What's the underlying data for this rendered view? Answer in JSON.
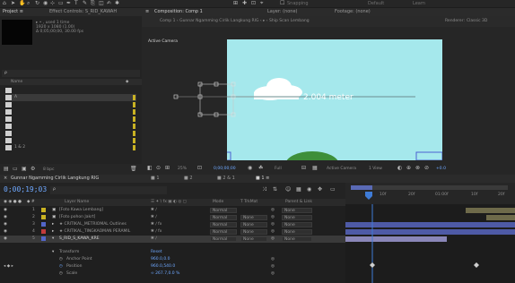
{
  "toolbar": {
    "snapping_label": "Snapping",
    "default_label": "Default",
    "learn_label": "Learn"
  },
  "project_panel": {
    "tab_label": "Project  ≡",
    "effect_tab_label": "Effect Controls: S_RID_KAWAH",
    "meta_lines": [
      "▸ • , used 1 time",
      "1920 x 1080 (1.00)",
      "Δ 0;05;00;00, 30.00 fps"
    ],
    "search_placeholder": "ρ",
    "column_name": "Name",
    "items": [
      "",
      "A",
      "",
      "",
      "",
      "",
      "",
      "",
      "1 & 2"
    ],
    "bpc": "8 bpc"
  },
  "viewer": {
    "tab_label": "Composition: Comp 1",
    "layer_tab": "Layer: (none)",
    "footage_tab": "Footage: (none)",
    "breadcrumb": "Comp 1  ‹  Gunnar Ngamming Cirlik Langkung RIG  ‹  ▸  ‹  Ship Scan Lembang",
    "renderer_label": "Renderer:",
    "renderer_value": "Classic 3D",
    "active_camera_overlay": "Active Camera",
    "distance_text": "2.004 meter",
    "footer": {
      "zoom": "25%",
      "timecode": "0;00;00;00",
      "resolution": "Full",
      "camera": "Active Camera",
      "view": "1 View",
      "exposure": "+0.0"
    }
  },
  "timeline": {
    "tab_label": "Gunnar Ngamming Cirlik Langkung RIG",
    "tab2": "■ 1",
    "tab3": "■ 2",
    "tab4": "■ 2 & 1",
    "tab5": "■ 1  ≡",
    "timecode": "0;00;19;03",
    "search_placeholder": "ρ",
    "ruler_ticks": [
      "10f",
      "20f",
      "01:00f",
      "10f",
      "20f"
    ],
    "columns": {
      "layer_name": "Layer Name",
      "switches": "☰ ✦ \\ fx ▣ ◐ ◎ ▢",
      "mode": "Mode",
      "trkmat": "T  TrkMat",
      "parent": "Parent & Link"
    },
    "layers": [
      {
        "num": "1",
        "name": "[Foto Kawa Lembang]",
        "mode": "Normal",
        "trkmat": "",
        "parent": "None",
        "label": "#c9b223",
        "bar_color": "#6e6a4a",
        "bar_start": 0.71,
        "bar_end": 1.0
      },
      {
        "num": "2",
        "name": "[Foto pohon Jakrt]",
        "mode": "Normal",
        "trkmat": "None",
        "parent": "None",
        "label": "#c9b223",
        "bar_color": "#6e6a4a",
        "bar_start": 0.83,
        "bar_end": 1.0
      },
      {
        "num": "3",
        "name": "★ CRITIKAL_METRIOMAL Outlines",
        "mode": "Normal",
        "trkmat": "None",
        "parent": "None",
        "label": "#5366c9",
        "bar_color": "#4e5aa6",
        "bar_start": 0.0,
        "bar_end": 1.0
      },
      {
        "num": "4",
        "name": "★ CRITIKAL_TINGKAOMAN PERAMIL",
        "mode": "Normal",
        "trkmat": "None",
        "parent": "None",
        "label": "#c23b3b",
        "bar_color": "#4e5aa6",
        "bar_start": 0.0,
        "bar_end": 1.0
      },
      {
        "num": "5",
        "name": "S_RID_S_KAWA_KRE",
        "mode": "Normal",
        "trkmat": "None",
        "parent": "None",
        "label": "#5366c9",
        "bar_color": "#8a86b8",
        "bar_start": 0.0,
        "bar_end": 0.6
      }
    ],
    "transform_label": "Transform",
    "reset_label": "Reset",
    "properties": [
      {
        "name": "Anchor Point",
        "value": "960.0,0.0"
      },
      {
        "name": "Position",
        "value": "960.0,540.0"
      },
      {
        "name": "Scale",
        "value": "∞ 267.7,0.0 %"
      }
    ]
  }
}
